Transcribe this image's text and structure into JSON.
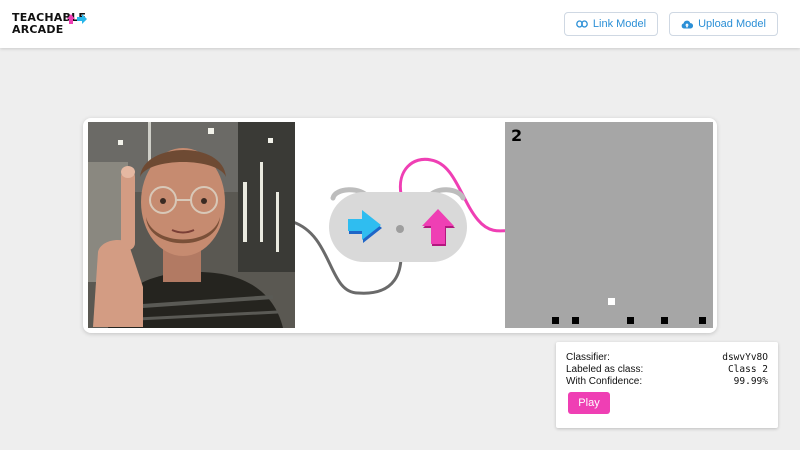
{
  "header": {
    "logo_line1": "TEACHABLE",
    "logo_line2": "ARCADE",
    "link_model_label": "Link Model",
    "upload_model_label": "Upload Model"
  },
  "colors": {
    "accent_blue": "#2b8fd6",
    "pink": "#ef3fb4",
    "cyan": "#27b6ea",
    "game_bg": "#a6a6a6"
  },
  "game": {
    "score": "2"
  },
  "classifier_panel": {
    "classifier_label": "Classifier:",
    "classifier_value": "dswvYv8O",
    "labeled_label": "Labeled as class:",
    "labeled_value": "Class 2",
    "confidence_label": "With Confidence:",
    "confidence_value": "99.99%",
    "play_label": "Play"
  }
}
